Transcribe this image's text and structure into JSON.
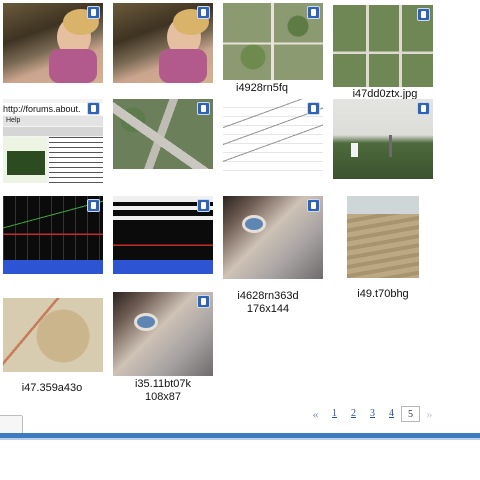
{
  "thumbnails": [
    {
      "icon": "photo-badge-icon"
    },
    {
      "icon": "photo-badge-icon"
    },
    {
      "icon": "photo-badge-icon",
      "caption": "i4928rn5fq"
    },
    {
      "icon": "photo-badge-icon",
      "caption": "i47dd0ztx.jpg"
    },
    {
      "icon": "photo-badge-icon",
      "snippet_url": "http://forums.about.",
      "snippet_menu": "Help"
    },
    {
      "icon": "photo-badge-icon"
    },
    {
      "icon": "photo-badge-icon"
    },
    {
      "icon": "photo-badge-icon"
    },
    {
      "icon": "photo-badge-icon"
    },
    {
      "icon": "photo-badge-icon"
    },
    {
      "icon": "photo-badge-icon",
      "caption": "i4628rn363d",
      "dimensions": "176x144"
    },
    {
      "icon": "photo-badge-icon",
      "caption": "i49.t70bhg"
    },
    {
      "icon": "photo-badge-icon",
      "caption": "i47.359a43o"
    },
    {
      "icon": "photo-badge-icon",
      "caption": "i35.11bt07k",
      "dimensions": "108x87"
    }
  ],
  "pagination": {
    "prev": "«",
    "pages": [
      "1",
      "2",
      "3",
      "4",
      "5"
    ],
    "current": "5",
    "next": "»"
  },
  "colors": {
    "badge": "#2f63b5",
    "bar": "#3f7bc0",
    "link": "#2b4f9b"
  }
}
